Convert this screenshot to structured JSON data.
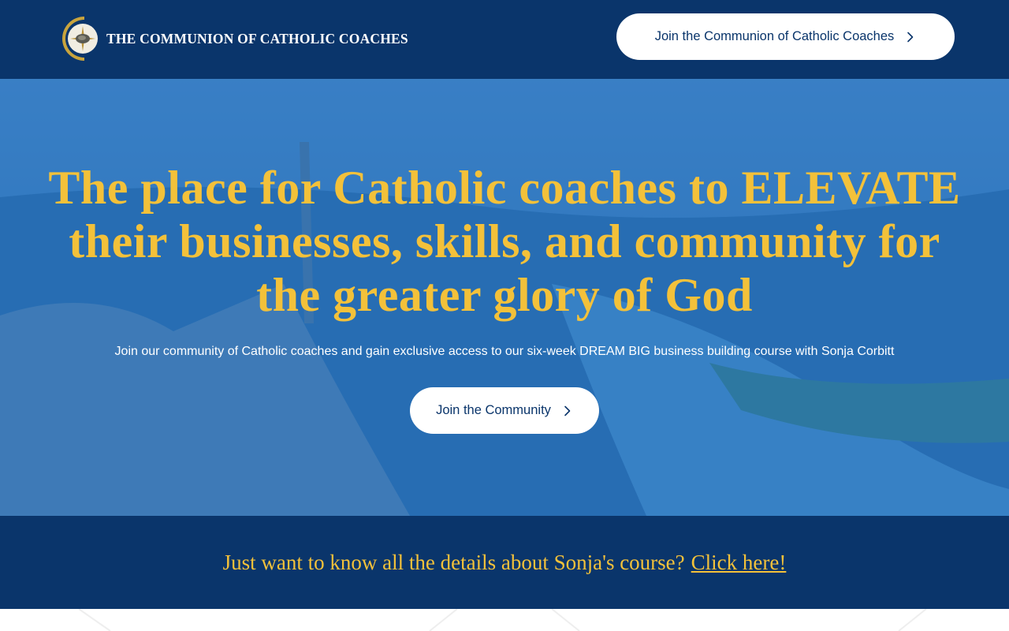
{
  "header": {
    "logo_text": "THE COMMUNION OF CATHOLIC COACHES",
    "cta_label": "Join the Communion of Catholic Coaches"
  },
  "hero": {
    "title": "The place for Catholic coaches to ELEVATE their businesses, skills, and community for the greater glory of God",
    "subtitle": "Join our community of Catholic coaches and gain exclusive access to our six-week DREAM BIG business building course with Sonja Corbitt",
    "cta_label": "Join the Community"
  },
  "band": {
    "text": "Just want to know all the details about Sonja's course?",
    "link_label": "Click here!"
  },
  "colors": {
    "navy": "#0a356b",
    "gold": "#f3c13a",
    "hero_blue": "#1e73c0",
    "white": "#ffffff"
  },
  "icons": {
    "logo": "catholic-coaches-emblem",
    "chevron": "chevron-right-icon"
  }
}
